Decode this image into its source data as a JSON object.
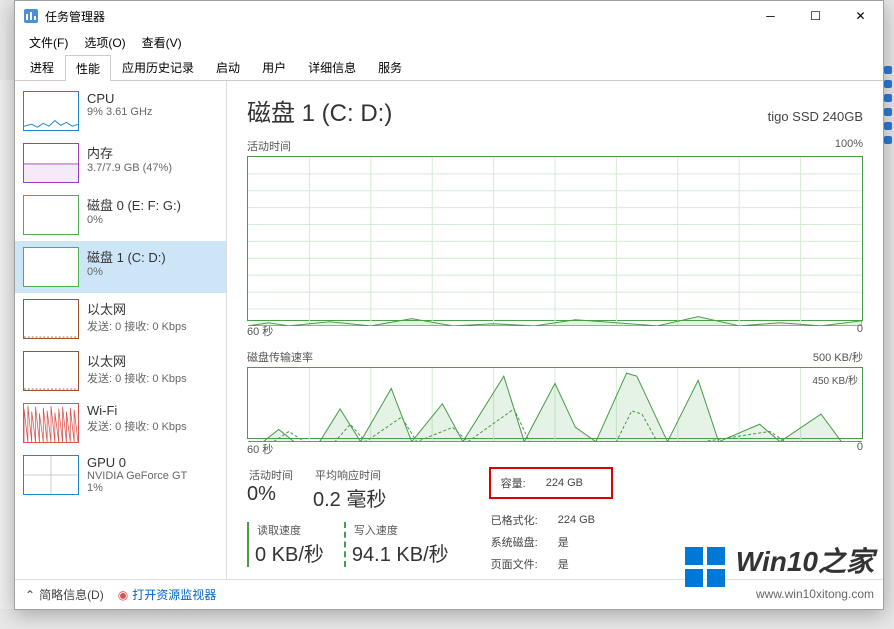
{
  "window": {
    "title": "任务管理器"
  },
  "menu": {
    "file": "文件(F)",
    "options": "选项(O)",
    "view": "查看(V)"
  },
  "tabs": [
    "进程",
    "性能",
    "应用历史记录",
    "启动",
    "用户",
    "详细信息",
    "服务"
  ],
  "active_tab": 1,
  "sidebar": {
    "items": [
      {
        "title": "CPU",
        "sub": "9% 3.61 GHz",
        "type": "cpu"
      },
      {
        "title": "内存",
        "sub": "3.7/7.9 GB (47%)",
        "type": "mem"
      },
      {
        "title": "磁盘 0 (E: F: G:)",
        "sub": "0%",
        "type": "disk"
      },
      {
        "title": "磁盘 1 (C: D:)",
        "sub": "0%",
        "type": "disk",
        "selected": true
      },
      {
        "title": "以太网",
        "sub": "发送: 0 接收: 0 Kbps",
        "type": "eth"
      },
      {
        "title": "以太网",
        "sub": "发送: 0 接收: 0 Kbps",
        "type": "eth"
      },
      {
        "title": "Wi-Fi",
        "sub": "发送: 0 接收: 0 Kbps",
        "type": "wifi"
      },
      {
        "title": "GPU 0",
        "sub": "NVIDIA GeForce GT",
        "sub2": "1%",
        "type": "gpu"
      }
    ]
  },
  "main": {
    "title": "磁盘 1 (C: D:)",
    "model": "tigo SSD 240GB",
    "chart1": {
      "label": "活动时间",
      "max": "100%",
      "xleft": "60 秒",
      "xright": "0"
    },
    "chart2": {
      "label": "磁盘传输速率",
      "max": "500 KB/秒",
      "inner_label": "450 KB/秒",
      "xleft": "60 秒",
      "xright": "0"
    },
    "stats": {
      "active_label": "活动时间",
      "active_value": "0%",
      "resp_label": "平均响应时间",
      "resp_value": "0.2 毫秒",
      "read_label": "读取速度",
      "read_value": "0 KB/秒",
      "write_label": "写入速度",
      "write_value": "94.1 KB/秒"
    },
    "props": {
      "capacity_label": "容量:",
      "capacity_value": "224 GB",
      "formatted_label": "已格式化:",
      "formatted_value": "224 GB",
      "sysdisk_label": "系统磁盘:",
      "sysdisk_value": "是",
      "pagefile_label": "页面文件:",
      "pagefile_value": "是"
    }
  },
  "statusbar": {
    "less": "简略信息(D)",
    "resmon": "打开资源监视器"
  },
  "watermark": {
    "line1": "Win10之家",
    "line2": "www.win10xitong.com"
  },
  "chart_data": [
    {
      "type": "line",
      "title": "活动时间",
      "xlabel": "60 秒 → 0",
      "ylabel": "%",
      "ylim": [
        0,
        100
      ],
      "x_range_seconds": 60,
      "series": [
        {
          "name": "活动时间",
          "values": [
            0,
            2,
            0,
            0,
            3,
            1,
            0,
            0,
            5,
            0,
            2,
            0,
            0,
            4,
            0,
            0,
            1,
            0,
            0,
            6,
            2,
            0,
            0,
            0,
            3,
            0,
            0,
            2,
            0,
            0
          ]
        }
      ]
    },
    {
      "type": "line",
      "title": "磁盘传输速率",
      "xlabel": "60 秒 → 0",
      "ylabel": "KB/秒",
      "ylim": [
        0,
        500
      ],
      "x_range_seconds": 60,
      "series": [
        {
          "name": "读取",
          "values": [
            0,
            50,
            0,
            0,
            120,
            0,
            0,
            300,
            0,
            0,
            200,
            0,
            0,
            450,
            0,
            0,
            380,
            100,
            0,
            480,
            460,
            200,
            0,
            0,
            420,
            0,
            0,
            150,
            0,
            0
          ]
        },
        {
          "name": "写入",
          "values": [
            0,
            0,
            50,
            0,
            0,
            80,
            0,
            0,
            150,
            0,
            0,
            90,
            0,
            0,
            200,
            0,
            0,
            0,
            0,
            180,
            190,
            0,
            0,
            0,
            0,
            0,
            60,
            0,
            0,
            0
          ]
        }
      ]
    }
  ]
}
